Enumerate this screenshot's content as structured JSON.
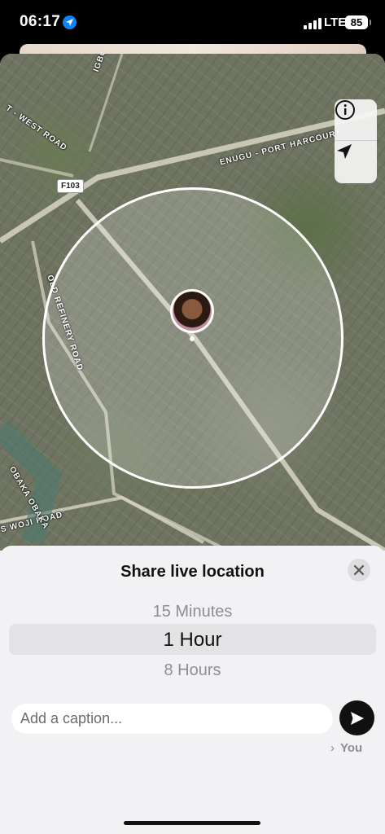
{
  "status_bar": {
    "time": "06:17",
    "network": "LTE",
    "battery": "85",
    "icons": [
      "location-arrow-icon",
      "signal-icon",
      "battery-icon"
    ]
  },
  "map": {
    "road_labels": {
      "igbo_etche": "IGBO ETCHE",
      "west_road": "T - WEST ROAD",
      "enugu_port_harcourt": "ENUGU - PORT HARCOURT",
      "route_f103": "F103",
      "refinery_road": "OLD REFINERY ROAD",
      "woji_road": "S WOJI ROAD",
      "obaka": "OBAKA OBAKA"
    },
    "controls": {
      "info_icon": "info-icon",
      "location_icon": "navigation-arrow-icon"
    }
  },
  "sheet": {
    "title": "Share live location",
    "close_icon": "close-icon",
    "durations": {
      "previous": "15 Minutes",
      "selected": "1 Hour",
      "next": "8 Hours"
    },
    "caption_placeholder": "Add a caption...",
    "send_icon": "send-icon",
    "recipient": "You"
  },
  "colors": {
    "accent": "#0a84ff",
    "sheet_background": "#f2f2f4",
    "send_button": "#111111"
  }
}
